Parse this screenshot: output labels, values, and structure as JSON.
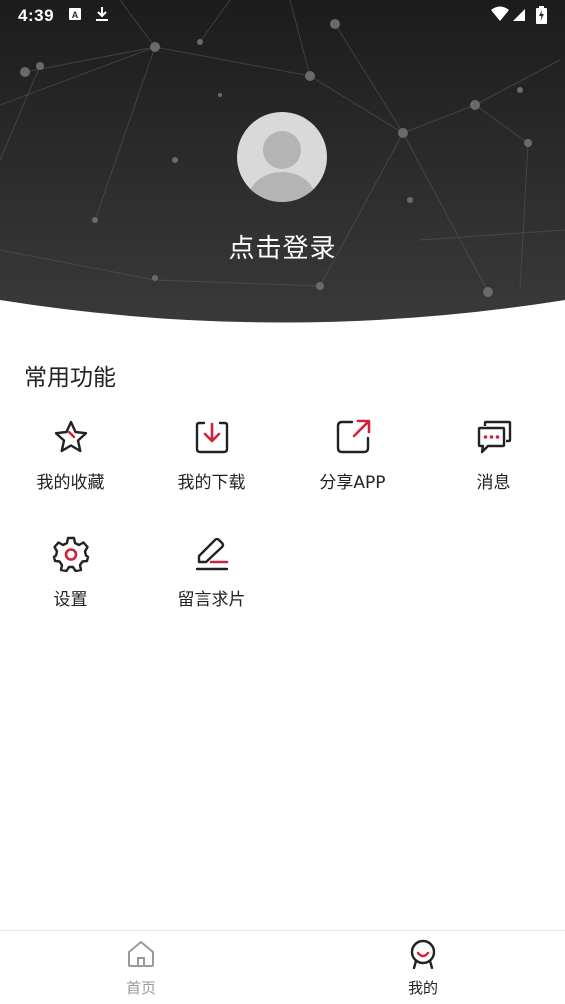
{
  "status_bar": {
    "time": "4:39"
  },
  "header": {
    "login_label": "点击登录"
  },
  "section": {
    "title": "常用功能"
  },
  "functions": [
    {
      "label": "我的收藏",
      "icon": "star-icon"
    },
    {
      "label": "我的下载",
      "icon": "download-icon"
    },
    {
      "label": "分享APP",
      "icon": "share-icon"
    },
    {
      "label": "消息",
      "icon": "message-icon"
    },
    {
      "label": "设置",
      "icon": "gear-icon"
    },
    {
      "label": "留言求片",
      "icon": "edit-icon"
    }
  ],
  "tabbar": {
    "tabs": [
      {
        "label": "首页",
        "icon": "home-icon",
        "active": false
      },
      {
        "label": "我的",
        "icon": "profile-icon",
        "active": true
      }
    ]
  },
  "colors": {
    "accent": "#d0223a",
    "header_bg": "#2a2a2a",
    "inactive_tab": "#9a9a9a",
    "active_tab": "#222222"
  }
}
